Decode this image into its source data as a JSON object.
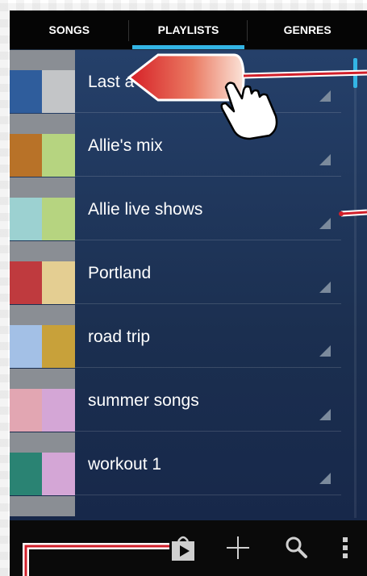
{
  "tabs": [
    {
      "label": "SONGS",
      "active": false
    },
    {
      "label": "PLAYLISTS",
      "active": true
    },
    {
      "label": "GENRES",
      "active": false
    }
  ],
  "playlists": [
    {
      "label": "Last a",
      "colors": [
        "#2f5d9c",
        "#c3c5c7"
      ]
    },
    {
      "label": "Allie's mix",
      "colors": [
        "#b87228",
        "#b6d480"
      ]
    },
    {
      "label": "Allie live shows",
      "colors": [
        "#9cd1d1",
        "#b6d480"
      ]
    },
    {
      "label": "Portland",
      "colors": [
        "#bf3a3e",
        "#e4ce92"
      ]
    },
    {
      "label": "road trip",
      "colors": [
        "#a3c0e6",
        "#c8a13a"
      ]
    },
    {
      "label": "summer songs",
      "colors": [
        "#e2a6b2",
        "#d4a6d6"
      ]
    },
    {
      "label": "workout 1",
      "colors": [
        "#2a8373",
        "#d4a6d6"
      ]
    }
  ],
  "toolbar": {
    "icons": [
      "shop-icon",
      "add-icon",
      "search-icon",
      "overflow-menu-icon"
    ]
  },
  "colors": {
    "accent": "#33b5e5",
    "callout": "#d11f2a"
  }
}
